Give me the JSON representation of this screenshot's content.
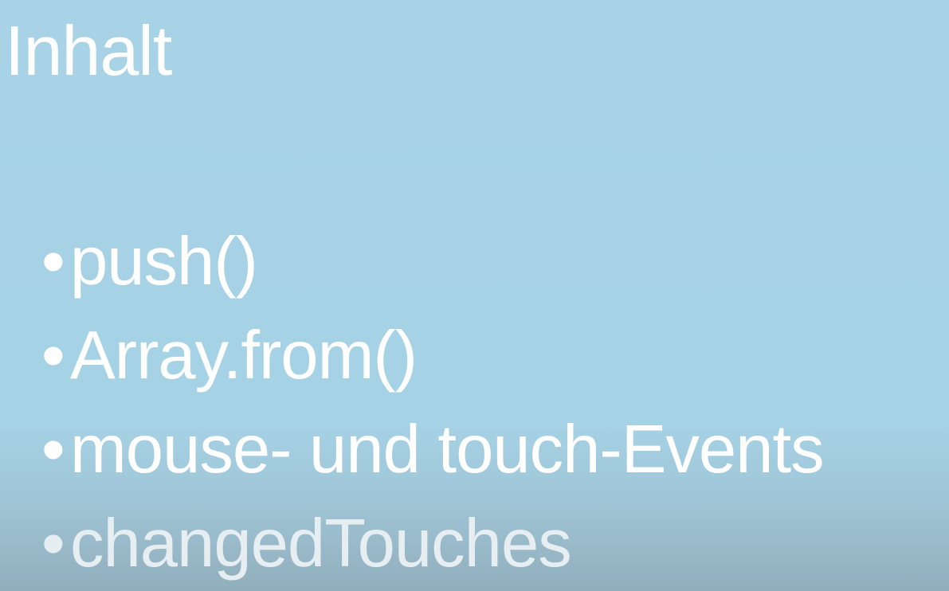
{
  "slide": {
    "title": "Inhalt",
    "bullet_glyph": "•",
    "items": [
      {
        "label": "push()"
      },
      {
        "label": "Array.from()"
      },
      {
        "label": "mouse- und touch-Events"
      },
      {
        "label": "changedTouches"
      }
    ]
  },
  "colors": {
    "background": "#a6d2e5",
    "text": "#ffffff"
  }
}
